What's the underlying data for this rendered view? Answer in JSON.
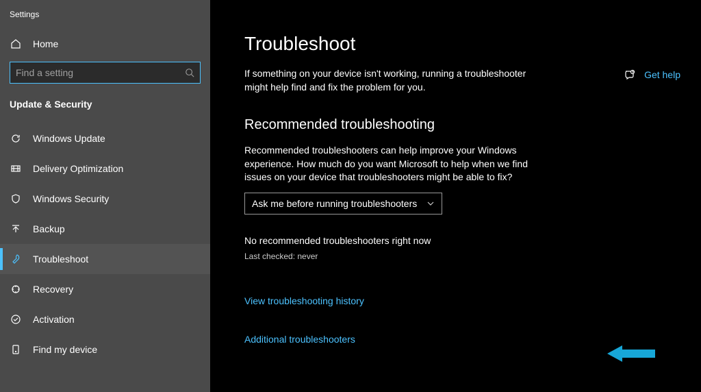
{
  "window": {
    "title": "Settings"
  },
  "sidebar": {
    "home_label": "Home",
    "search_placeholder": "Find a setting",
    "section_title": "Update & Security",
    "items": [
      {
        "label": "Windows Update",
        "icon": "sync-icon"
      },
      {
        "label": "Delivery Optimization",
        "icon": "delivery-icon"
      },
      {
        "label": "Windows Security",
        "icon": "shield-icon"
      },
      {
        "label": "Backup",
        "icon": "backup-icon"
      },
      {
        "label": "Troubleshoot",
        "icon": "troubleshoot-icon",
        "active": true
      },
      {
        "label": "Recovery",
        "icon": "recovery-icon"
      },
      {
        "label": "Activation",
        "icon": "activation-icon"
      },
      {
        "label": "Find my device",
        "icon": "find-device-icon"
      }
    ]
  },
  "main": {
    "title": "Troubleshoot",
    "description": "If something on your device isn't working, running a troubleshooter might help find and fix the problem for you.",
    "recommended": {
      "heading": "Recommended troubleshooting",
      "description": "Recommended troubleshooters can help improve your Windows experience. How much do you want Microsoft to help when we find issues on your device that troubleshooters might be able to fix?",
      "dropdown_value": "Ask me before running troubleshooters",
      "status": "No recommended troubleshooters right now",
      "last_checked": "Last checked: never"
    },
    "links": {
      "history": "View troubleshooting history",
      "additional": "Additional troubleshooters"
    },
    "help_label": "Get help"
  }
}
